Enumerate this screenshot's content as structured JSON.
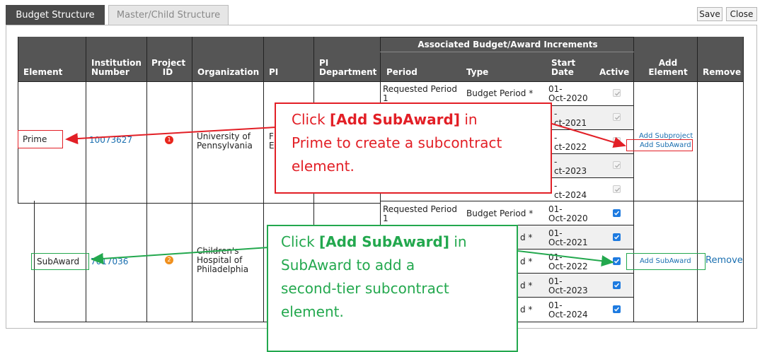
{
  "tabs": [
    {
      "label": "Budget Structure",
      "active": true
    },
    {
      "label": "Master/Child Structure",
      "active": false
    }
  ],
  "toolbar": {
    "save_label": "Save",
    "close_label": "Close"
  },
  "table": {
    "group_header": "Associated Budget/Award Increments",
    "headers": {
      "element": "Element",
      "institution_number_1": "Institution",
      "institution_number_2": "Number",
      "project_id_1": "Project",
      "project_id_2": "ID",
      "organization": "Organization",
      "pi": "PI",
      "pi_department_1": "PI",
      "pi_department_2": "Department",
      "period": "Period",
      "type": "Type",
      "start_date_1": "Start",
      "start_date_2": "Date",
      "active": "Active",
      "add_element_1": "Add",
      "add_element_2": "Element",
      "remove": "Remove"
    },
    "rows": [
      {
        "element": "Prime",
        "institution_number": "10073627",
        "project_badge": "1",
        "project_badge_color": "#e8261c",
        "organization_1": "University of",
        "organization_2": "Pennsylvania",
        "pi_partial_1": "F",
        "pi_partial_2": "E",
        "periods": [
          {
            "period_1": "Requested Period",
            "period_2": "1",
            "type": "Budget Period *",
            "start_1": "01-",
            "start_2": "Oct-2020",
            "active": true,
            "enabled": false
          },
          {
            "start_1": "-",
            "start_2": "ct-2021",
            "active": true,
            "enabled": false
          },
          {
            "start_1": "-",
            "start_2": "ct-2022",
            "active": true,
            "enabled": false
          },
          {
            "start_1": "-",
            "start_2": "ct-2023",
            "active": true,
            "enabled": false
          },
          {
            "start_1": "-",
            "start_2": "ct-2024",
            "active": true,
            "enabled": false
          }
        ],
        "add_subproject": "Add Subproject",
        "add_subaward": "Add SubAward"
      },
      {
        "element": "SubAward",
        "institution_number": "7017036",
        "project_badge": "2",
        "project_badge_color": "#f0901e",
        "organization_1": "Children's",
        "organization_2": "Hospital of",
        "organization_3": "Philadelphia",
        "periods": [
          {
            "period_1": "Requested Period",
            "period_2": "1",
            "type": "Budget Period *",
            "start_1": "01-",
            "start_2": "Oct-2020",
            "active": true,
            "enabled": true
          },
          {
            "type": "d *",
            "start_1": "01-",
            "start_2": "Oct-2021",
            "active": true,
            "enabled": true
          },
          {
            "type": "d *",
            "start_1": "01-",
            "start_2": "Oct-2022",
            "active": true,
            "enabled": true
          },
          {
            "type": "d *",
            "start_1": "01-",
            "start_2": "Oct-2023",
            "active": true,
            "enabled": true
          },
          {
            "type": "d *",
            "start_1": "01-",
            "start_2": "Oct-2024",
            "active": true,
            "enabled": true
          }
        ],
        "add_subaward": "Add SubAward",
        "remove": "Remove"
      }
    ]
  },
  "callouts": {
    "red": {
      "pre": "Click ",
      "bold": "[Add SubAward]",
      "post1": " in",
      "line2": "Prime to create a subcontract",
      "line3": "element."
    },
    "green": {
      "pre": "Click ",
      "bold": "[Add SubAward]",
      "post1": " in",
      "line2": "SubAward to add a",
      "line3": "second-tier subcontract",
      "line4": "element."
    }
  },
  "colors": {
    "header_bg": "#555555",
    "link": "#1a6fb0",
    "callout_red": "#e21f26",
    "callout_green": "#23a84e",
    "checkbox_on": "#1e7be0"
  }
}
